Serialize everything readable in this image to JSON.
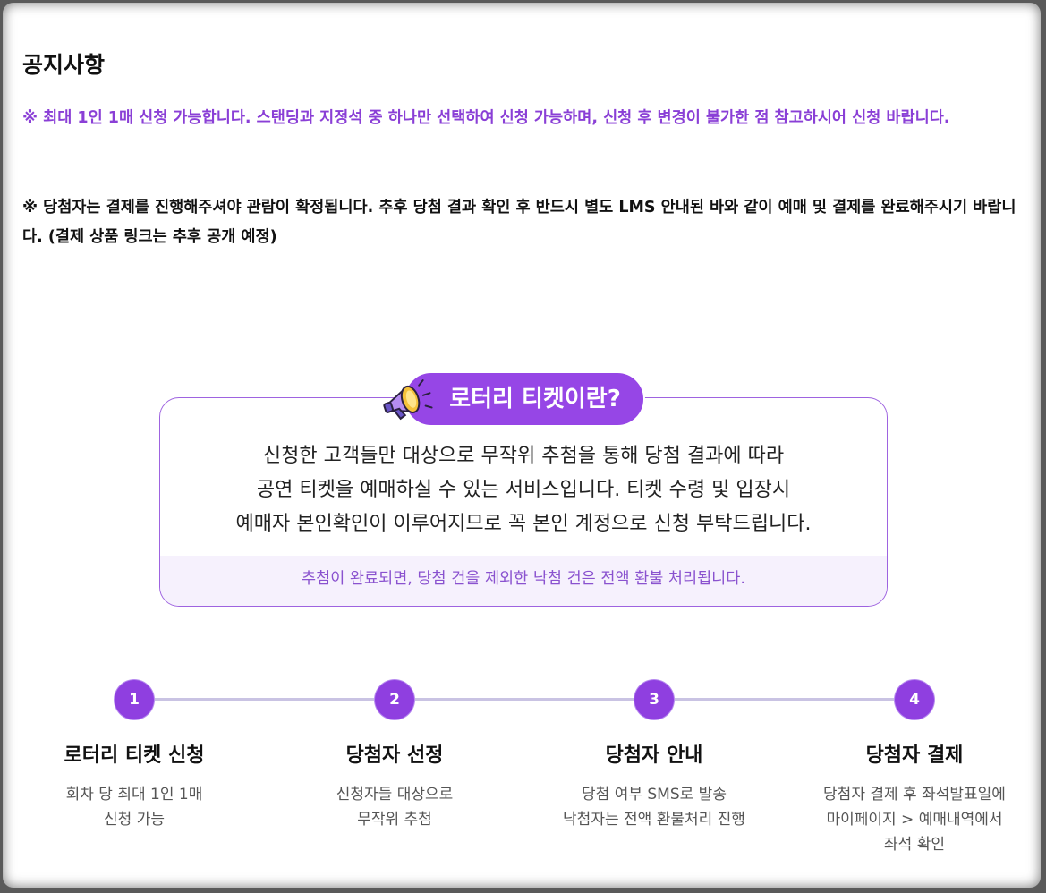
{
  "notice": {
    "title": "공지사항",
    "line1": "※ 최대 1인 1매 신청 가능합니다. 스탠딩과 지정석 중 하나만 선택하여 신청 가능하며, 신청 후 변경이 불가한 점 참고하시어 신청 바랍니다.",
    "line2": "※ 당첨자는 결제를 진행해주셔야 관람이 확정됩니다. 추후 당첨 결과 확인 후 반드시 별도 LMS 안내된 바와 같이 예매 및 결제를 완료해주시기 바랍니다. (결제 상품 링크는 추후 공개 예정)"
  },
  "lottery": {
    "heading": "로터리 티켓이란?",
    "body": [
      "신청한 고객들만 대상으로 무작위 추첨을 통해 당첨 결과에 따라",
      "공연 티켓을 예매하실 수 있는 서비스입니다. 티켓 수령 및 입장시",
      "예매자 본인확인이 이루어지므로 꼭 본인 계정으로 신청 부탁드립니다."
    ],
    "footnote": "추첨이 완료되면, 당첨 건을 제외한 낙첨 건은 전액 환불 처리됩니다.",
    "accent_color": "#9646e6",
    "icon": "megaphone-icon"
  },
  "steps": [
    {
      "num": "1",
      "title": "로터리 티켓 신청",
      "desc": [
        "회차 당 최대 1인 1매",
        "신청 가능"
      ]
    },
    {
      "num": "2",
      "title": "당첨자 선정",
      "desc": [
        "신청자들 대상으로",
        "무작위 추첨"
      ]
    },
    {
      "num": "3",
      "title": "당첨자 안내",
      "desc": [
        "당첨 여부 SMS로 발송",
        "낙첨자는 전액 환불처리 진행"
      ]
    },
    {
      "num": "4",
      "title": "당첨자 결제",
      "desc": [
        "당첨자 결제 후 좌석발표일에",
        "마이페이지 > 예매내역에서",
        "좌석 확인"
      ]
    }
  ]
}
